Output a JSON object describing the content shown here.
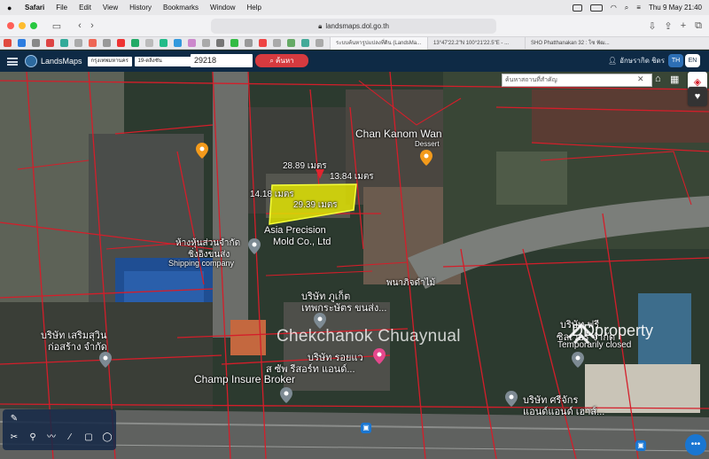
{
  "menubar": {
    "app": "Safari",
    "items": [
      "File",
      "Edit",
      "View",
      "History",
      "Bookmarks",
      "Window",
      "Help"
    ],
    "datetime": "Thu 9 May  21:40"
  },
  "browser": {
    "url": "landsmaps.dol.go.th",
    "tabs": [
      "ระบบค้นหารูปแปลงที่ดิน (LandsMa...",
      "13°47'22.2\"N 100°21'22.5\"E - ...",
      "SHO Phatthanakan 32 : โซ ฟัฒ..."
    ]
  },
  "app": {
    "brand": "LandsMaps",
    "province_select": "กรุงเทพมหานคร",
    "district_select": "19-ตลิ่งชัน",
    "parcel_number": "29218",
    "search_button": "ค้นหา",
    "user_name": "อักษรากิด ชิดร",
    "lang_th": "TH",
    "lang_en": "EN",
    "place_search_placeholder": "ค้นหาสถานที่สำคัญ"
  },
  "map": {
    "measurements": {
      "top": "28.89 เมตร",
      "right": "13.84 เมตร",
      "left": "14.18 เมตร",
      "bottom": "29.39 เมตร"
    },
    "labels": {
      "chan_kanom_wan": "Chan Kanom Wan",
      "dessert": "Dessert",
      "asia_precision_1": "Asia Precision",
      "asia_precision_2": "Mold Co., Ltd",
      "shipping_th_1": "ห้างหุ้นส่วนจำกัด",
      "shipping_th_2": "ชิ่งอิงขนส่ง",
      "shipping_en": "Shipping company",
      "company_th_1": "บริษัท ภูเก็ต",
      "company_th_2": "เทพกระษัตร ขนส่ง...",
      "company_th_3": "พนาภิจดำไม้",
      "serm_1": "บริษัท เสริมสุวิน",
      "serm_2": "ก่อสร้าง จำกัด",
      "roy_1": "บริษัท รอยแว",
      "roy_2": "ส ซัพ รีสอร์ท แอนด์...",
      "champ": "Champ Insure Broker",
      "free_1": "บริษัท ฟรี",
      "free_2": "ซิลเวอร์ จำกัด",
      "free_3": "Temporarily closed",
      "sri_1": "บริษัท ศรีจักร",
      "sri_2": "แอนด์แอนด์ เฮาส์..."
    },
    "watermark": "Chekchanok Chuaynual",
    "ddproperty": "DDproperty"
  },
  "colors": {
    "appbar": "#0e2a45",
    "parcel_fill": "#e5e800",
    "boundary": "#d41e2a",
    "search_button": "#d63a3f"
  }
}
